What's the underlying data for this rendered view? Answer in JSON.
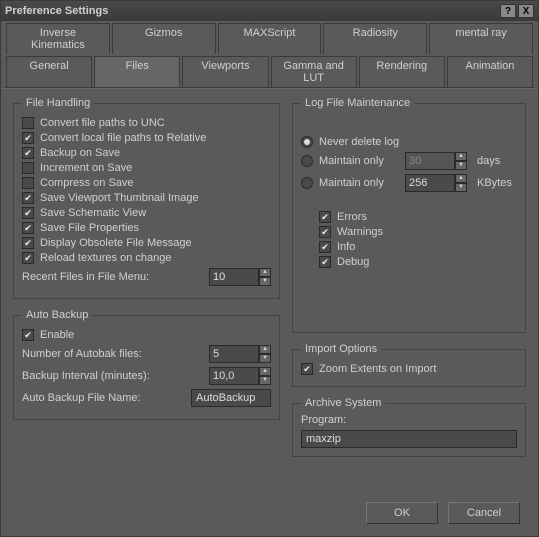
{
  "window": {
    "title": "Preference Settings",
    "help": "?",
    "close": "X"
  },
  "tabs_row1": [
    "Inverse Kinematics",
    "Gizmos",
    "MAXScript",
    "Radiosity",
    "mental ray"
  ],
  "tabs_row2": [
    "General",
    "Files",
    "Viewports",
    "Gamma and LUT",
    "Rendering",
    "Animation"
  ],
  "active_tab": "Files",
  "fileHandling": {
    "legend": "File Handling",
    "options": [
      {
        "label": "Convert file paths to UNC",
        "checked": false
      },
      {
        "label": "Convert local file paths to Relative",
        "checked": true
      },
      {
        "label": "Backup on Save",
        "checked": true
      },
      {
        "label": "Increment on Save",
        "checked": false
      },
      {
        "label": "Compress on Save",
        "checked": false
      },
      {
        "label": "Save Viewport Thumbnail Image",
        "checked": true
      },
      {
        "label": "Save Schematic View",
        "checked": true
      },
      {
        "label": "Save File Properties",
        "checked": true
      },
      {
        "label": "Display Obsolete File Message",
        "checked": true
      },
      {
        "label": "Reload textures on change",
        "checked": true
      }
    ],
    "recentLabel": "Recent Files in File Menu:",
    "recentValue": "10"
  },
  "autoBackup": {
    "legend": "Auto Backup",
    "enableLabel": "Enable",
    "enableChecked": true,
    "numLabel": "Number of Autobak files:",
    "numValue": "5",
    "intLabel": "Backup Interval (minutes):",
    "intValue": "10,0",
    "nameLabel": "Auto Backup File Name:",
    "nameValue": "AutoBackup"
  },
  "logMaint": {
    "legend": "Log File Maintenance",
    "opts": [
      {
        "label": "Never delete log",
        "sel": true
      },
      {
        "label": "Maintain only",
        "sel": false,
        "val": "30",
        "unit": "days",
        "disabled": true
      },
      {
        "label": "Maintain only",
        "sel": false,
        "val": "256",
        "unit": "KBytes",
        "disabled": false
      }
    ],
    "chks": [
      {
        "label": "Errors",
        "checked": true
      },
      {
        "label": "Warnings",
        "checked": true
      },
      {
        "label": "Info",
        "checked": true
      },
      {
        "label": "Debug",
        "checked": true
      }
    ]
  },
  "importOpts": {
    "legend": "Import Options",
    "zoomLabel": "Zoom Extents on Import",
    "zoomChecked": true
  },
  "archive": {
    "legend": "Archive System",
    "programLabel": "Program:",
    "programValue": "maxzip"
  },
  "buttons": {
    "ok": "OK",
    "cancel": "Cancel"
  }
}
